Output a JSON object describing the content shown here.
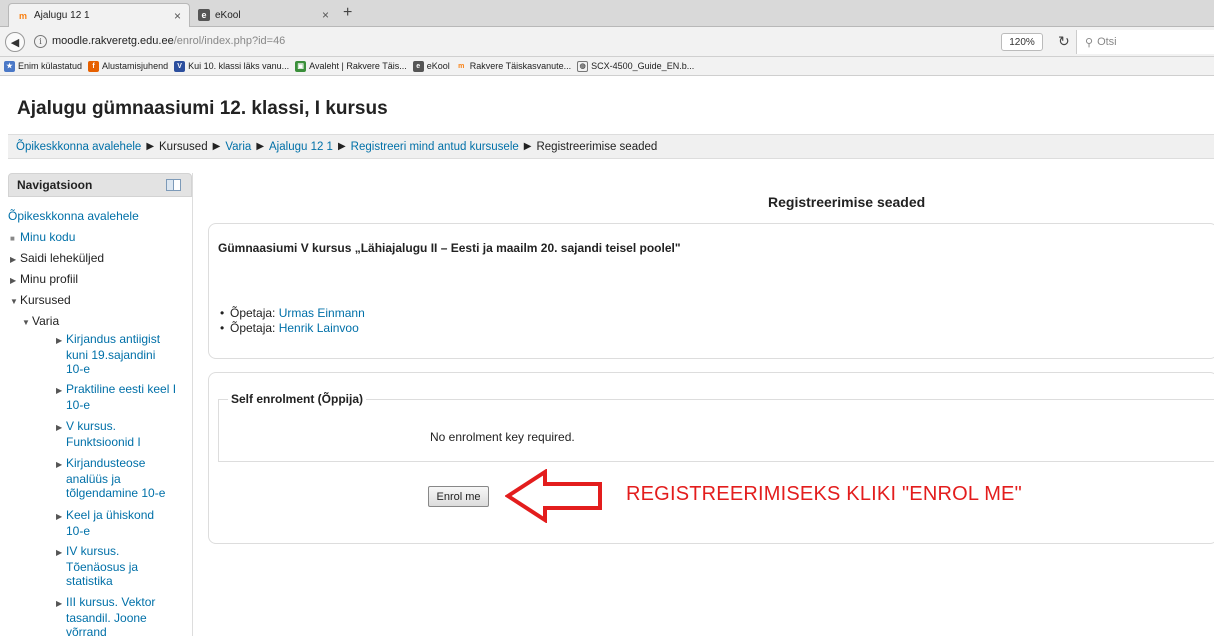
{
  "browser": {
    "tabs": [
      {
        "title": "Ajalugu 12 1",
        "close": "×"
      },
      {
        "title": "eKool",
        "close": "×"
      }
    ],
    "new_tab": "+",
    "url_host": "moodle.rakveretg.edu.ee",
    "url_path": "/enrol/index.php?id=46",
    "zoom": "120%",
    "search_placeholder": "Otsi",
    "bookmarks": [
      {
        "label": "Enim külastatud",
        "icon": "most-visited-icon"
      },
      {
        "label": "Alustamisjuhend",
        "icon": "firefox-icon"
      },
      {
        "label": "Kui 10. klassi läks vanu...",
        "icon": "vt-icon"
      },
      {
        "label": "Avaleht | Rakvere Täis...",
        "icon": "school-icon"
      },
      {
        "label": "eKool",
        "icon": "ekool-icon"
      },
      {
        "label": "Rakvere Täiskasvanute...",
        "icon": "moodle-icon"
      },
      {
        "label": "SCX-4500_Guide_EN.b...",
        "icon": "globe-icon"
      }
    ]
  },
  "page": {
    "heading": "Ajalugu gümnaasiumi 12. klassi, I kursus",
    "breadcrumb": [
      "Õpikeskkonna avalehele",
      "Kursused",
      "Varia",
      "Ajalugu 12 1",
      "Registreeri mind antud kursusele",
      "Registreerimise seaded"
    ]
  },
  "navigation": {
    "title": "Navigatsioon",
    "items": [
      {
        "label": "Õpikeskkonna avalehele"
      },
      {
        "label": "Minu kodu"
      },
      {
        "label": "Saidi leheküljed"
      },
      {
        "label": "Minu profiil"
      },
      {
        "label": "Kursused"
      },
      {
        "label": "Varia"
      },
      {
        "label": [
          "Kirjandus antiigist",
          "kuni 19.sajandini",
          "10-e"
        ]
      },
      {
        "label": [
          "Praktiline eesti keel I",
          "10-e"
        ]
      },
      {
        "label": [
          "V kursus.",
          "Funktsioonid I"
        ]
      },
      {
        "label": [
          "Kirjandusteose",
          "analüüs ja",
          "tõlgendamine 10-e"
        ]
      },
      {
        "label": [
          "Keel ja ühiskond",
          "10-e"
        ]
      },
      {
        "label": [
          "IV kursus.",
          "Tõenäosus ja",
          "statistika"
        ]
      },
      {
        "label": [
          "III kursus. Vektor",
          "tasandil. Joone",
          "võrrand"
        ]
      }
    ]
  },
  "main": {
    "title": "Registreerimise seaded",
    "course_summary": "Gümnaasiumi V kursus „Lähiajalugu II – Eesti ja maailm 20. sajandi teisel poolel\"",
    "teachers": [
      {
        "role": "Õpetaja:",
        "name": "Urmas Einmann"
      },
      {
        "role": "Õpetaja:",
        "name": "Henrik Lainvoo"
      }
    ],
    "enrol_section_title": "Self enrolment (Õppija)",
    "enrol_info": "No enrolment key required.",
    "enrol_button": "Enrol me"
  },
  "annotation": {
    "text": "REGISTREERIMISEKS KLIKI \"ENROL ME\"",
    "color": "#e31d1d"
  }
}
